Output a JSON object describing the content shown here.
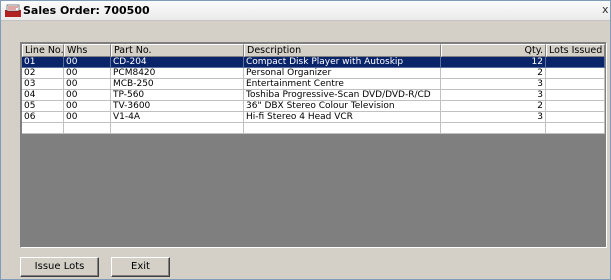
{
  "window": {
    "title": "Sales Order: 700500",
    "close_glyph": "x",
    "icon": "sales-order-icon"
  },
  "grid": {
    "columns": [
      "Line No.",
      "Whs",
      "Part No.",
      "Description",
      "Qty.",
      "Lots Issued"
    ],
    "rows": [
      {
        "line": "01",
        "whs": "00",
        "part": "CD-204",
        "description": "Compact Disk Player with Autoskip",
        "qty": "12",
        "lots": ""
      },
      {
        "line": "02",
        "whs": "00",
        "part": "PCM8420",
        "description": "Personal Organizer",
        "qty": "2",
        "lots": ""
      },
      {
        "line": "03",
        "whs": "00",
        "part": "MCB-250",
        "description": "Entertainment Centre",
        "qty": "3",
        "lots": ""
      },
      {
        "line": "04",
        "whs": "00",
        "part": "TP-560",
        "description": "Toshiba Progressive-Scan DVD/DVD-R/CD",
        "qty": "3",
        "lots": ""
      },
      {
        "line": "05",
        "whs": "00",
        "part": "TV-3600",
        "description": "36\" DBX Stereo Colour Television",
        "qty": "2",
        "lots": ""
      },
      {
        "line": "06",
        "whs": "00",
        "part": "V1-4A",
        "description": "Hi-fi Stereo 4 Head VCR",
        "qty": "3",
        "lots": ""
      },
      {
        "line": "",
        "whs": "",
        "part": "",
        "description": "",
        "qty": "",
        "lots": ""
      }
    ],
    "selected_row": 0
  },
  "buttons": {
    "issue_lots": "Issue Lots",
    "exit": "Exit"
  },
  "colors": {
    "selection": "#0a246a",
    "grid_background": "#7f7f7f",
    "window_background": "#d4d0c8"
  }
}
